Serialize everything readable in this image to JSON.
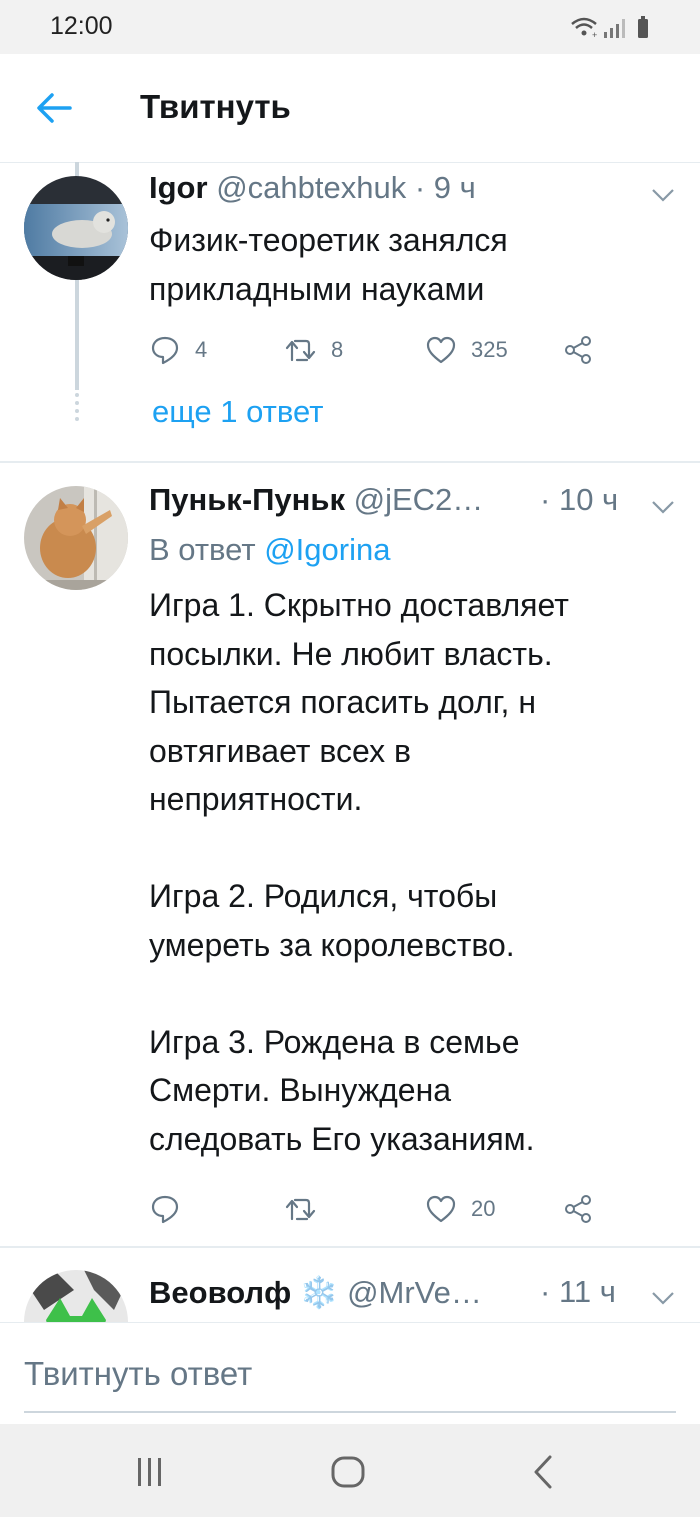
{
  "status_bar": {
    "time": "12:00"
  },
  "header": {
    "title": "Твитнуть"
  },
  "tweets": [
    {
      "name": "Igor",
      "handle": "@cahbtexhuk",
      "sep": "·",
      "time": "9 ч",
      "text": "Физик-теоретик занялся\nприкладными науками",
      "counts": {
        "reply": "4",
        "retweet": "8",
        "like": "325"
      }
    },
    {
      "name": "Пуньк-Пуньк",
      "handle": "@jEC2…",
      "sep": "·",
      "time": "10 ч",
      "reply_prefix": "В ответ",
      "reply_mention": "@Igorina",
      "text": "Игра 1. Скрытно доставляет\nпосылки. Не любит власть.\nПытается погасить долг, н\nовтягивает всех в\nнеприятности.\n\nИгра 2. Родился, чтобы\nумереть за королевство.\n\nИгра 3. Рождена в семье\nСмерти. Вынуждена\nследовать Его указаниям.",
      "counts": {
        "reply": "",
        "retweet": "",
        "like": "20"
      }
    },
    {
      "name": "Веоволф",
      "badge": "❄️",
      "handle": "@MrVe…",
      "sep": "·",
      "time": "11 ч"
    }
  ],
  "more_replies": "еще 1 ответ",
  "composer": {
    "placeholder": "Твитнуть ответ"
  },
  "icons": {
    "back": "arrow-left-icon",
    "reply": "reply-icon",
    "retweet": "retweet-icon",
    "like": "heart-icon",
    "share": "share-icon",
    "chevron": "chevron-down-icon"
  },
  "colors": {
    "accent": "#1da1f2",
    "secondary_text": "#657786",
    "divider": "#e6ecf0"
  }
}
